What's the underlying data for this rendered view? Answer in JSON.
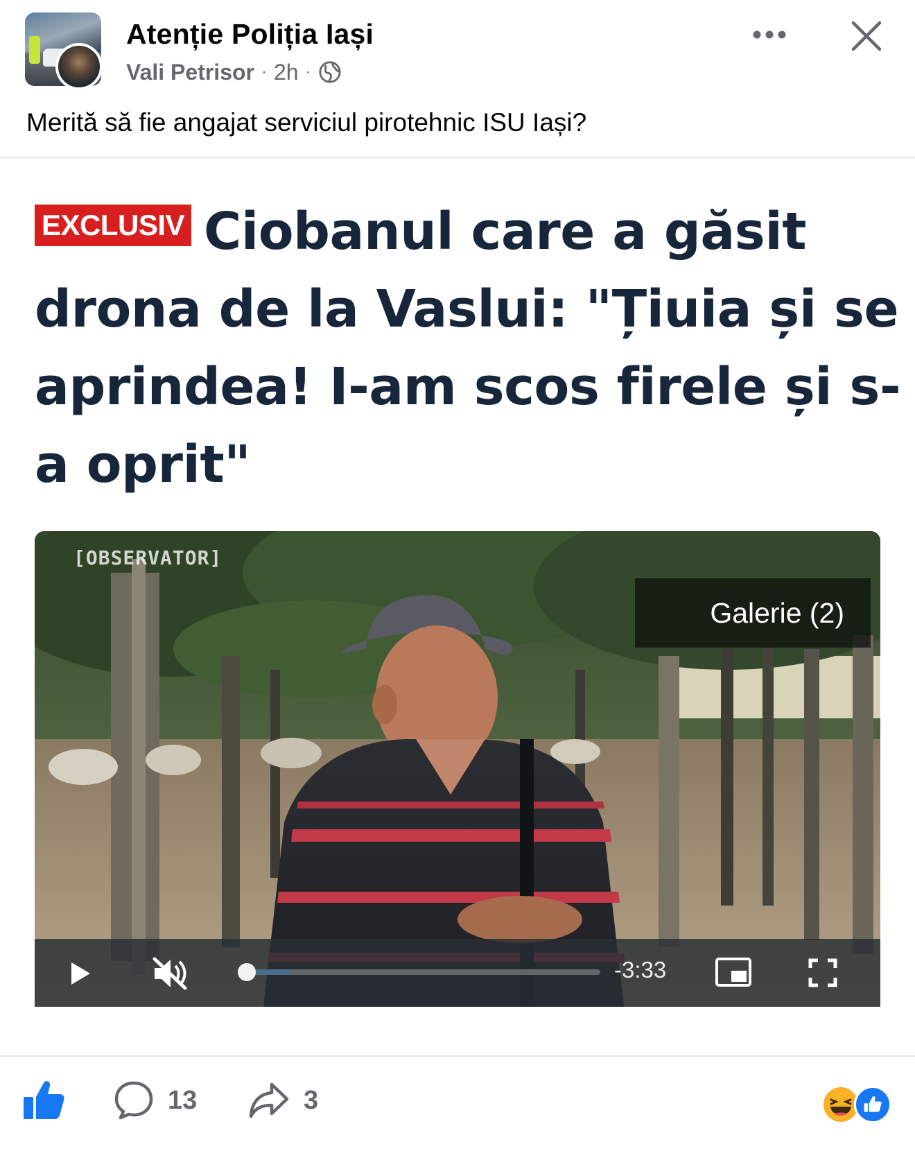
{
  "post": {
    "group_name": "Atenție Poliția Iași",
    "author": "Vali Petrisor",
    "time": "2h",
    "separator": "·",
    "text": "Merită să fie angajat serviciul pirotehnic ISU Iași?"
  },
  "article": {
    "badge": "EXCLUSIV",
    "headline_lines": [
      "Ciobanul care a găsit",
      "drona de la Vaslui: \"Țiuia și se",
      "aprindea! I-am scos firele și s-",
      "a oprit\""
    ]
  },
  "video": {
    "watermark": "[OBSERVATOR]",
    "gallery_label": "Galerie (2)",
    "time_remaining": "-3:33",
    "progress_fraction": 0.02,
    "buffered_fraction": 0.14
  },
  "actions": {
    "comment_count": "13",
    "share_count": "3",
    "reactions": [
      "haha-icon",
      "like-icon"
    ]
  },
  "colors": {
    "brand_blue": "#1877f2",
    "headline": "#17263a",
    "badge_red": "#d71f1f",
    "secondary_text": "#65676b"
  },
  "icons": {
    "header_more": "more-dots-icon",
    "header_close": "close-icon",
    "audience": "globe-icon",
    "like": "thumbs-up-icon",
    "comment": "comment-bubble-icon",
    "share": "share-arrow-icon",
    "play": "play-icon",
    "mute": "muted-speaker-icon",
    "pip": "picture-in-picture-icon",
    "fullscreen": "fullscreen-icon"
  }
}
